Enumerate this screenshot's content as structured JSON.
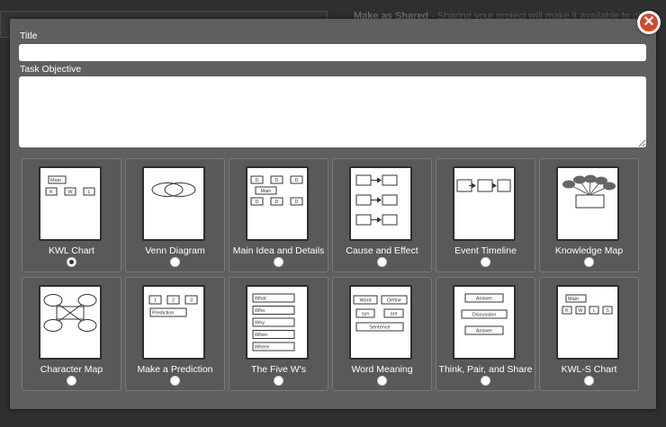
{
  "background": {
    "notice_bold": "Make as Shared",
    "notice_text": " - Sharing your project will make it available to other"
  },
  "modal": {
    "title_label": "Title",
    "title_value": "",
    "objective_label": "Task Objective",
    "objective_value": "",
    "close_glyph": "✕"
  },
  "organizers": [
    {
      "label": "KWL Chart",
      "icon": "kwl-chart-icon",
      "selected": true,
      "thumb_text": [
        "Main",
        "K",
        "W",
        "L"
      ]
    },
    {
      "label": "Venn Diagram",
      "icon": "venn-diagram-icon",
      "selected": false,
      "thumb_text": []
    },
    {
      "label": "Main Idea and Details",
      "icon": "main-idea-icon",
      "selected": false,
      "thumb_text": [
        "D",
        "D",
        "D",
        "Main",
        "D",
        "D",
        "D"
      ]
    },
    {
      "label": "Cause and Effect",
      "icon": "cause-effect-icon",
      "selected": false,
      "thumb_text": []
    },
    {
      "label": "Event Timeline",
      "icon": "event-timeline-icon",
      "selected": false,
      "thumb_text": []
    },
    {
      "label": "Knowledge Map",
      "icon": "knowledge-map-icon",
      "selected": false,
      "thumb_text": []
    },
    {
      "label": "Character Map",
      "icon": "character-map-icon",
      "selected": false,
      "thumb_text": []
    },
    {
      "label": "Make a Prediction",
      "icon": "prediction-icon",
      "selected": false,
      "thumb_text": [
        "1",
        "2",
        "3",
        "Prediction"
      ]
    },
    {
      "label": "The Five W's",
      "icon": "five-ws-icon",
      "selected": false,
      "thumb_text": [
        "What",
        "Who",
        "Why",
        "When",
        "Where"
      ]
    },
    {
      "label": "Word Meaning",
      "icon": "word-meaning-icon",
      "selected": false,
      "thumb_text": [
        "Word",
        "Define",
        "syn",
        "ant",
        "Sentence"
      ]
    },
    {
      "label": "Think, Pair, and Share",
      "icon": "think-pair-share-icon",
      "selected": false,
      "thumb_text": [
        "Answer",
        "Discussion",
        "Answer"
      ]
    },
    {
      "label": "KWL-S Chart",
      "icon": "kwls-chart-icon",
      "selected": false,
      "thumb_text": [
        "Main",
        "K",
        "W",
        "L",
        "S"
      ]
    }
  ],
  "colors": {
    "modal_bg": "#5f5f5f",
    "close_red": "#d24a2b",
    "card_bg": "#595959",
    "knowledge_blob": "#666666"
  }
}
